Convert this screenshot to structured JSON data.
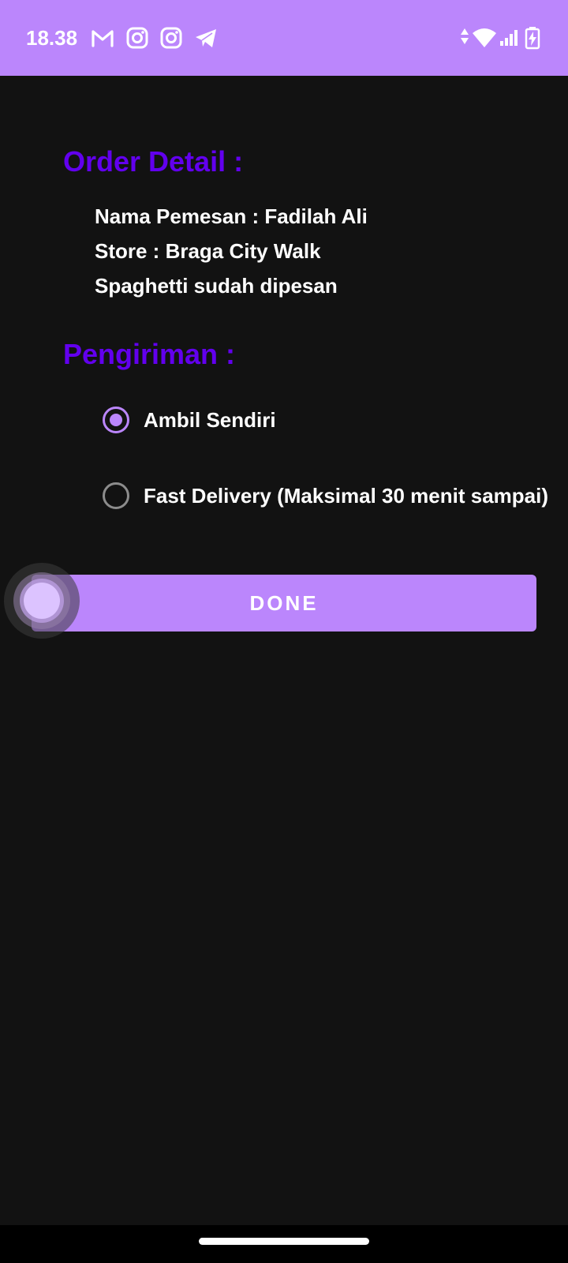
{
  "status_bar": {
    "time": "18.38",
    "left_icons": [
      "gmail-icon",
      "instagram-icon",
      "instagram-icon",
      "telegram-icon"
    ],
    "right_icons": [
      "data-arrows-icon",
      "wifi-icon",
      "signal-icon",
      "battery-charging-icon"
    ],
    "background_color": "#bb86fc"
  },
  "order_detail": {
    "heading": "Order Detail :",
    "lines": [
      "Nama Pemesan : Fadilah Ali",
      "Store : Braga City Walk",
      "Spaghetti sudah dipesan"
    ]
  },
  "delivery": {
    "heading": "Pengiriman :",
    "options": [
      {
        "label": "Ambil Sendiri",
        "selected": true
      },
      {
        "label": "Fast Delivery (Maksimal 30 menit sampai)",
        "selected": false
      }
    ]
  },
  "done_button": {
    "label": "DONE"
  },
  "colors": {
    "background": "#121212",
    "accent": "#bb86fc",
    "heading": "#6200ee",
    "text": "#ffffff",
    "radio_unselected": "#8c8c8c"
  }
}
